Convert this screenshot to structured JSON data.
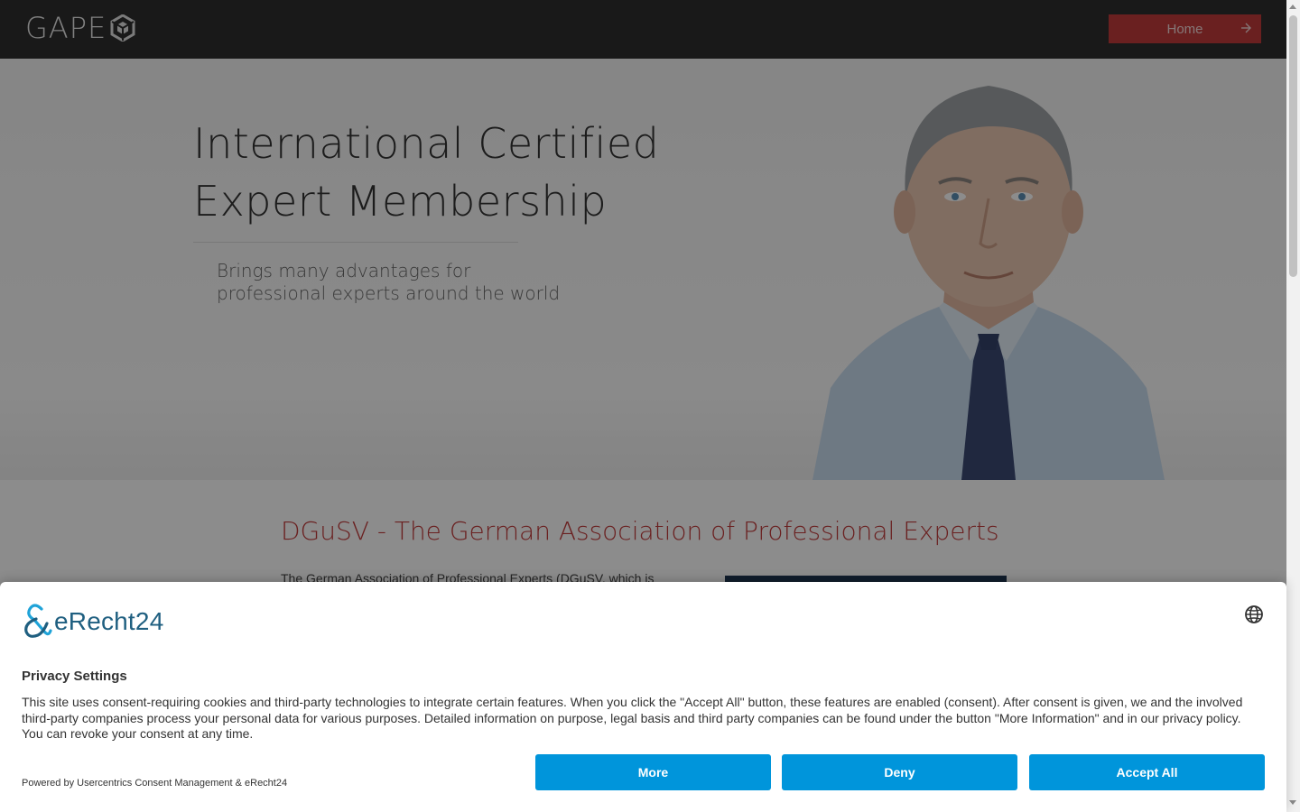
{
  "header": {
    "logo_text": "GAPE",
    "home_label": "Home"
  },
  "hero": {
    "title_line1": "International Certified",
    "title_line2": "Expert Membership",
    "subtitle_line1": "Brings many advantages for",
    "subtitle_line2": "professional experts around the world"
  },
  "section": {
    "title": "DGuSV - The German Association of Professional Experts",
    "text": "The German Association of Professional Experts (DGuSV, which is"
  },
  "consent": {
    "brand": "eRecht24",
    "title": "Privacy Settings",
    "text": "This site uses consent-requiring cookies and third-party technologies to integrate certain features. When you click the \"Accept All\" button, these features are enabled (consent). After consent is given, we and the involved third-party companies process your personal data for various purposes. Detailed information on purpose, legal basis and third party companies can be found under the button \"More Information\" and in our privacy policy. You can revoke your consent at any time.",
    "powered_by": "Powered by Usercentrics Consent Management & eRecht24",
    "buttons": {
      "more": "More",
      "deny": "Deny",
      "accept": "Accept All"
    }
  },
  "colors": {
    "accent_red": "#c23b3b",
    "consent_blue": "#0095db",
    "brand_teal": "#1f5f80"
  },
  "icons": {
    "home_arrow": "arrow-right-icon",
    "language": "globe-icon",
    "logo_mark": "gape-mark-icon",
    "erecht_mark": "erecht-ampersand-icon"
  }
}
